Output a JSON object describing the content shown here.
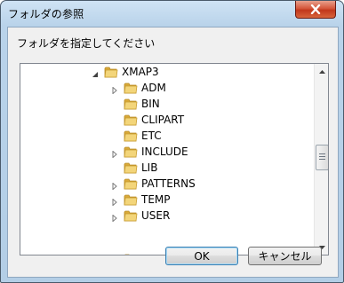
{
  "window": {
    "title": "フォルダの参照"
  },
  "dialog": {
    "prompt": "フォルダを指定してください"
  },
  "tree": {
    "root": {
      "label": "XMAP3",
      "expanded": true
    },
    "items": [
      {
        "label": "ADM",
        "has_children": true
      },
      {
        "label": "BIN",
        "has_children": false
      },
      {
        "label": "CLIPART",
        "has_children": false
      },
      {
        "label": "ETC",
        "has_children": false
      },
      {
        "label": "INCLUDE",
        "has_children": true
      },
      {
        "label": "LIB",
        "has_children": false
      },
      {
        "label": "PATTERNS",
        "has_children": true
      },
      {
        "label": "TEMP",
        "has_children": true
      },
      {
        "label": "USER",
        "has_children": true
      }
    ]
  },
  "buttons": {
    "ok": "OK",
    "cancel": "キャンセル"
  },
  "icons": {
    "close": "close-icon",
    "folder": "folder-icon",
    "expand": "chevron-right-icon",
    "collapse": "chevron-down-icon"
  },
  "colors": {
    "folder": "#e8c65a",
    "title_bar": "#b9d3ea",
    "close_button": "#c94a2e",
    "default_button_border": "#3c7fb1"
  }
}
